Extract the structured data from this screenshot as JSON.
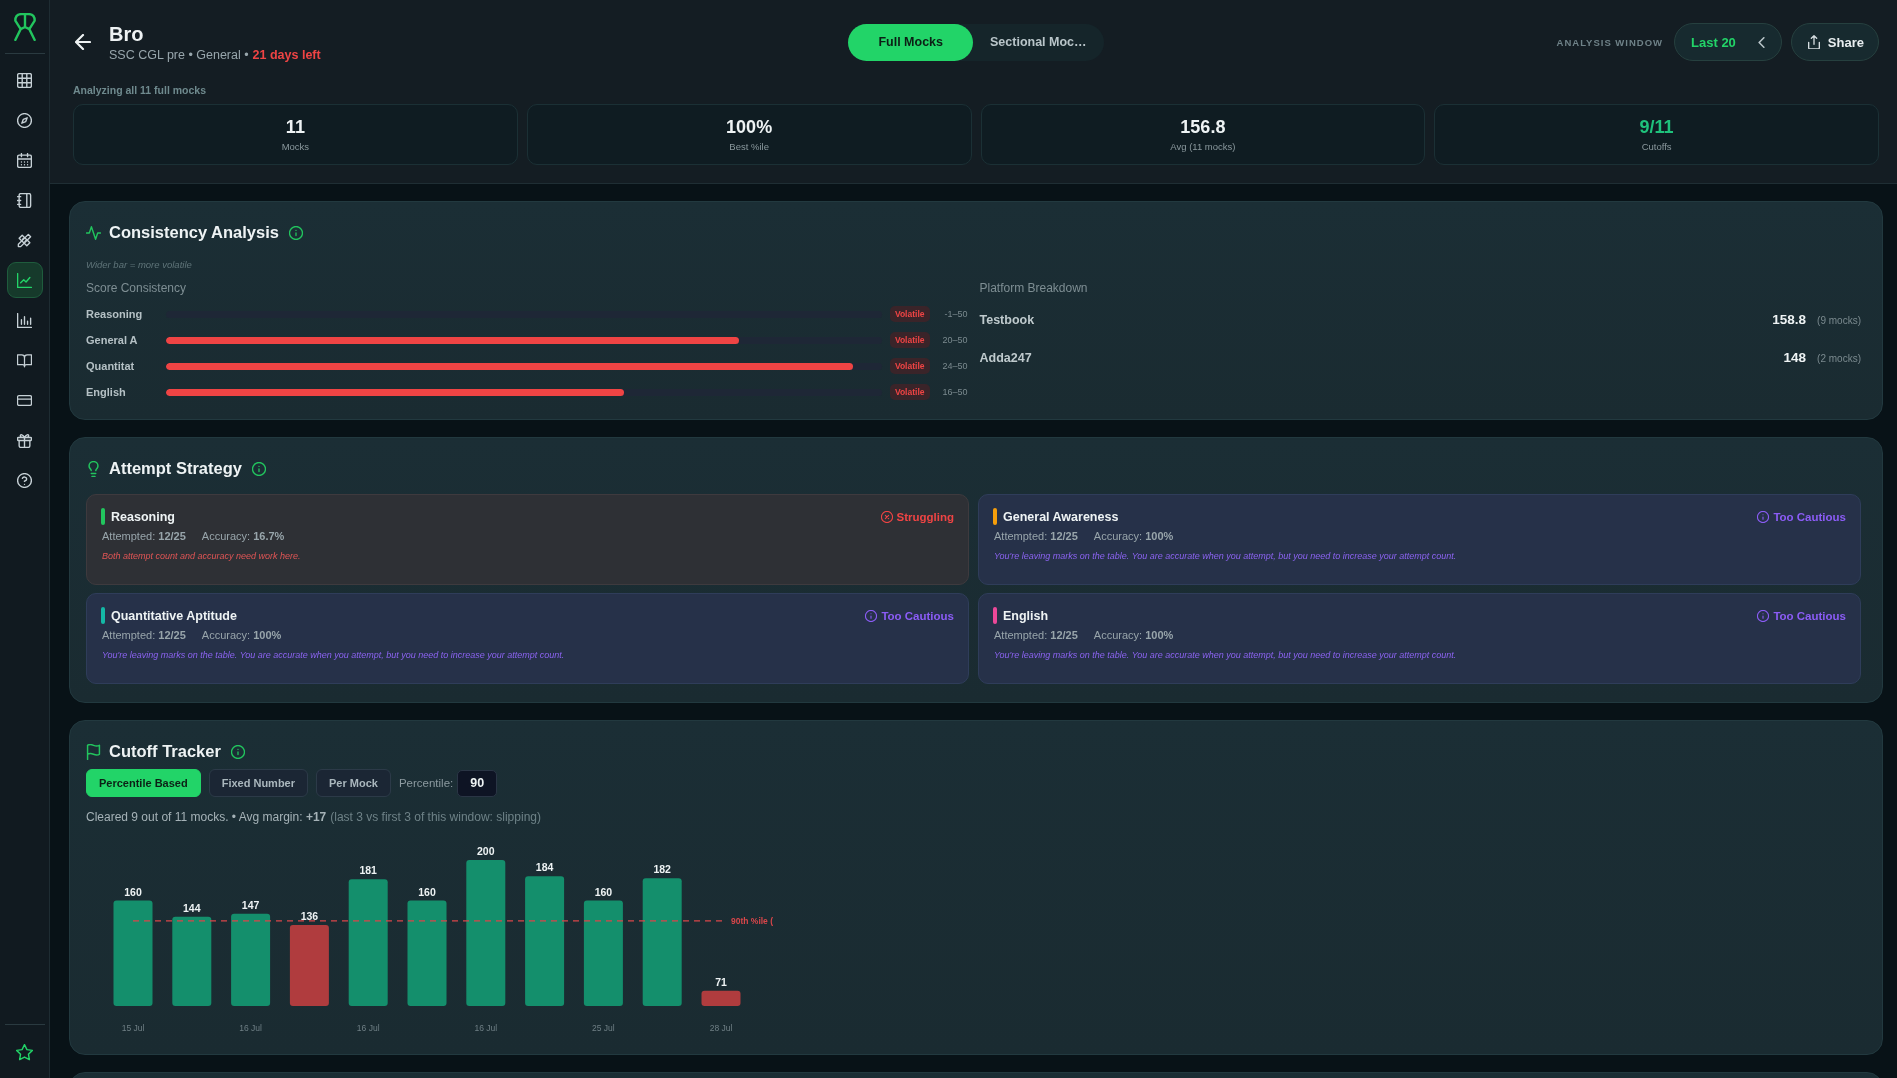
{
  "sidebar": {
    "items": [
      {
        "selected": false
      },
      {
        "selected": false
      },
      {
        "selected": false
      },
      {
        "selected": false
      },
      {
        "selected": false
      },
      {
        "selected": true
      },
      {
        "selected": false
      },
      {
        "selected": false
      },
      {
        "selected": false
      },
      {
        "selected": false
      },
      {
        "selected": false
      }
    ]
  },
  "header": {
    "title": "Bro",
    "subtitle": "SSC CGL pre • General •",
    "countdown": "21 days left",
    "tabs": [
      {
        "label": "Full Mocks",
        "selected": true
      },
      {
        "label": "Sectional Moc…",
        "selected": false
      }
    ],
    "analysis_window": {
      "label": "ANALYSIS WINDOW",
      "value": "Last 20"
    },
    "share_button": "Share",
    "scope_note": "Analyzing all 11 full mocks",
    "stats": [
      {
        "value": "11",
        "label": "Mocks",
        "accent": false
      },
      {
        "value": "100%",
        "label": "Best %ile",
        "accent": false
      },
      {
        "value": "156.8",
        "label": "Avg (11 mocks)",
        "accent": false
      },
      {
        "value": "9/11",
        "label": "Cutoffs",
        "accent": true
      }
    ]
  },
  "consistency": {
    "title": "Consistency Analysis",
    "hint": "Wider bar = more volatile",
    "score_heading": "Score Consistency",
    "rows": [
      {
        "label": "Reasoning",
        "badge": "Volatile",
        "range": "-1–50"
      },
      {
        "label": "General A",
        "level": 0.8,
        "badge": "Volatile",
        "range": "20–50"
      },
      {
        "label": "Quantitat",
        "level": 0.96,
        "badge": "Volatile",
        "range": "24–50"
      },
      {
        "label": "English",
        "level": 0.64,
        "badge": "Volatile",
        "range": "16–50"
      }
    ],
    "platform_heading": "Platform Breakdown",
    "platforms": [
      {
        "name": "Testbook",
        "score": "158.8",
        "count": "(9 mocks)"
      },
      {
        "name": "Adda247",
        "score": "148",
        "count": "(2 mocks)"
      }
    ]
  },
  "attempt_strategy": {
    "title": "Attempt Strategy",
    "cards": [
      {
        "subject": "Reasoning",
        "color": "#22c55e",
        "status": {
          "kind": "struggling",
          "label": "Struggling"
        },
        "attempted": "Attempted: **12/25**",
        "accuracy": "Accuracy: **16.7%**",
        "note": "Both attempt count and accuracy need work here."
      },
      {
        "subject": "General Awareness",
        "color": "#f59e0b",
        "status": {
          "kind": "cautious",
          "label": "Too Cautious"
        },
        "attempted": "Attempted: **12/25**",
        "accuracy": "Accuracy: **100%**",
        "note": "You're leaving marks on the table. You are accurate when you attempt, but you need to increase your attempt count."
      },
      {
        "subject": "Quantitative Aptitude",
        "color": "#14b8a6",
        "status": {
          "kind": "cautious",
          "label": "Too Cautious"
        },
        "attempted": "Attempted: **12/25**",
        "accuracy": "Accuracy: **100%**",
        "note": "You're leaving marks on the table. You are accurate when you attempt, but you need to increase your attempt count."
      },
      {
        "subject": "English",
        "color": "#ec4899",
        "status": {
          "kind": "cautious",
          "label": "Too Cautious"
        },
        "attempted": "Attempted: **12/25**",
        "accuracy": "Accuracy: **100%**",
        "note": "You're leaving marks on the table. You are accurate when you attempt, but you need to increase your attempt count."
      }
    ]
  },
  "cutoff_tracker": {
    "title": "Cutoff Tracker",
    "modes": [
      {
        "label": "Percentile Based",
        "selected": true
      },
      {
        "label": "Fixed Number",
        "selected": false
      },
      {
        "label": "Per Mock",
        "selected": false
      }
    ],
    "percentile": {
      "label": "Percentile:",
      "value": "90"
    },
    "summary": "Cleared 9 out of 11 mocks. • Avg margin: **+17**",
    "trend": "(last 3 vs first 3 of this window: slipping)",
    "chart_data": {
      "type": "bar",
      "categories": [
        "15 Jul",
        null,
        "16 Jul",
        null,
        "16 Jul",
        null,
        "16 Jul",
        null,
        "25 Jul",
        null,
        "28 Jul"
      ],
      "values": [
        160,
        144,
        147,
        136,
        181,
        160,
        200,
        184,
        160,
        182,
        71
      ],
      "ylim": [
        56,
        200
      ],
      "data_labels": true,
      "ref_lines": [
        {
          "axis": "y",
          "value": 140,
          "label": "90th %ile (",
          "color": "#d9464a"
        }
      ]
    }
  }
}
